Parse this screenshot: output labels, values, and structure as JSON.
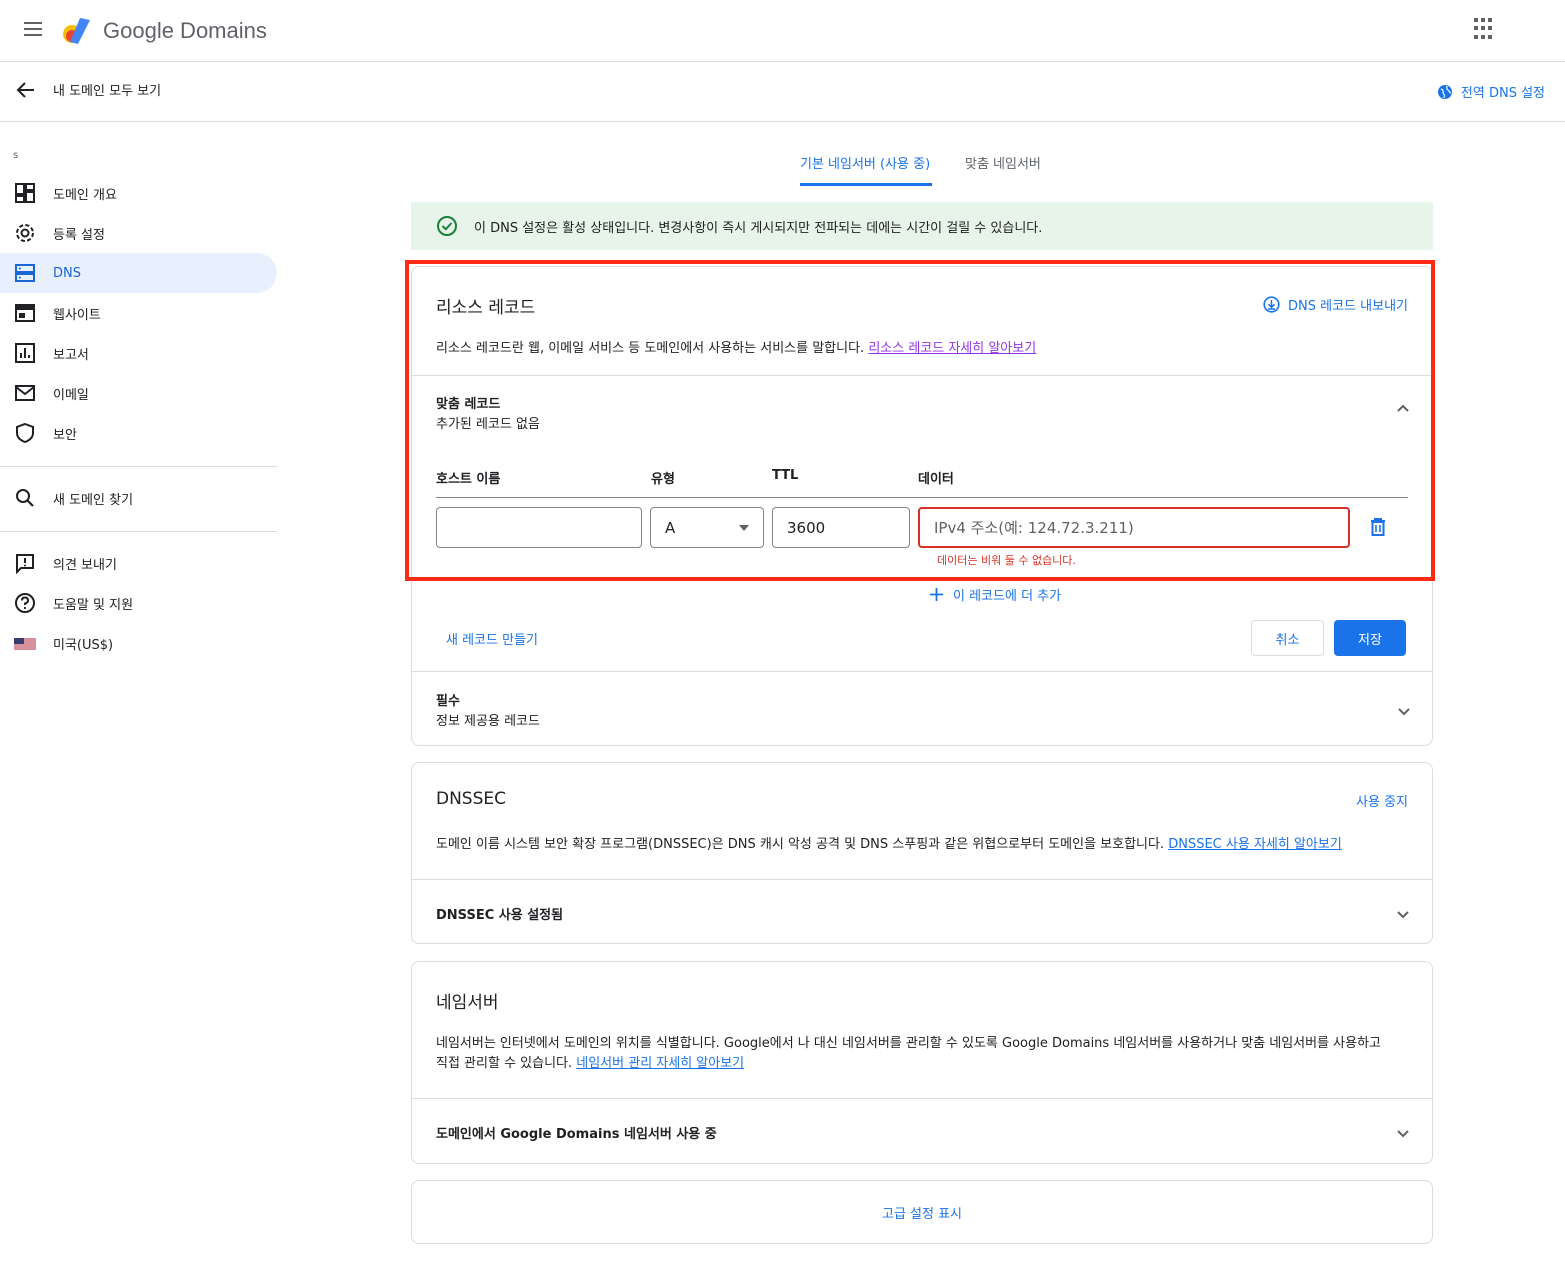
{
  "app": {
    "logo_text": "Google Domains"
  },
  "subbar": {
    "back_label": "내 도메인 모두 보기",
    "global_dns": "전역 DNS 설정"
  },
  "sidebar": {
    "domain_initial": "s",
    "items": [
      {
        "label": "도메인 개요",
        "icon": "dashboard-icon"
      },
      {
        "label": "등록 설정",
        "icon": "gear-icon"
      },
      {
        "label": "DNS",
        "icon": "dns-icon",
        "active": true
      },
      {
        "label": "웹사이트",
        "icon": "web-icon"
      },
      {
        "label": "보고서",
        "icon": "chart-icon"
      },
      {
        "label": "이메일",
        "icon": "mail-icon"
      },
      {
        "label": "보안",
        "icon": "shield-icon"
      }
    ],
    "find_domain": "새 도메인 찾기",
    "feedback": "의견 보내기",
    "help": "도움말 및 지원",
    "locale": "미국(US$)"
  },
  "tabs": [
    {
      "label": "기본 네임서버 (사용 중)",
      "active": true
    },
    {
      "label": "맞춤 네임서버"
    }
  ],
  "banner": {
    "text": "이 DNS 설정은 활성 상태입니다. 변경사항이 즉시 게시되지만 전파되는 데에는 시간이 걸릴 수 있습니다."
  },
  "resource_records": {
    "title": "리소스 레코드",
    "export_label": "DNS 레코드 내보내기",
    "desc": "리소스 레코드란 웹, 이메일 서비스 등 도메인에서 사용하는 서비스를 말합니다. ",
    "desc_link": "리소스 레코드 자세히 알아보기",
    "custom_title": "맞춤 레코드",
    "custom_sub": "추가된 레코드 없음",
    "columns": {
      "host": "호스트 이름",
      "type": "유형",
      "ttl": "TTL",
      "data": "데이터"
    },
    "row": {
      "host": "",
      "type": "A",
      "ttl": "3600",
      "data_placeholder": "IPv4 주소(예: 124.72.3.211)"
    },
    "error": "데이터는 비워 둘 수 없습니다.",
    "add_more": "이 레코드에 더 추가",
    "new_record": "새 레코드 만들기",
    "cancel": "취소",
    "save": "저장",
    "required_title": "필수",
    "required_sub": "정보 제공용 레코드"
  },
  "dnssec": {
    "title": "DNSSEC",
    "disable": "사용 중지",
    "desc": "도메인 이름 시스템 보안 확장 프로그램(DNSSEC)은 DNS 캐시 악성 공격 및 DNS 스푸핑과 같은 위협으로부터 도메인을 보호합니다. ",
    "desc_link": "DNSSEC 사용 자세히 알아보기",
    "status": "DNSSEC 사용 설정됨"
  },
  "nameservers": {
    "title": "네임서버",
    "desc1": "네임서버는 인터넷에서 도메인의 위치를 식별합니다. Google에서 나 대신 네임서버를 관리할 수 있도록 Google Domains 네임서버를 사용하거나 맞춤 네임서버를 사용하고",
    "desc2": "직접 관리할 수 있습니다. ",
    "desc_link": "네임서버 관리 자세히 알아보기",
    "status": "도메인에서 Google Domains 네임서버 사용 중"
  },
  "advanced": {
    "label": "고급 설정 표시"
  },
  "colors": {
    "accent": "#1a73e8",
    "error": "#d93025",
    "success_bg": "#e6f4ea",
    "highlight": "#ff2a14"
  }
}
